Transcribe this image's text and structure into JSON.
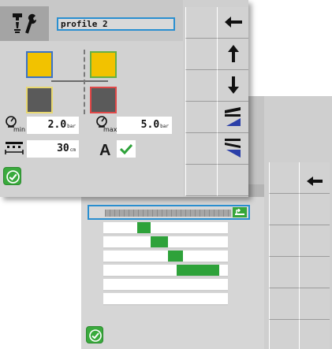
{
  "front": {
    "header": {
      "profile_name": "profile 2"
    },
    "pressure": {
      "min_sub": "min",
      "min_value": "2.0",
      "min_unit": "bar",
      "max_sub": "max",
      "max_value": "5.0",
      "max_unit": "bar"
    },
    "spacing": {
      "value": "30",
      "unit": "cm"
    },
    "auto": {
      "label": "A"
    },
    "colors": {
      "yellow": "#f2c200",
      "dark": "#5a5a5a",
      "green": "#36a63a",
      "blue": "#2a8fd0",
      "red": "#e04848"
    },
    "icons": {
      "tool": "tool-settings-icon",
      "back": "arrow-left-icon",
      "up": "arrow-up-icon",
      "down": "arrow-down-icon",
      "raise": "boom-raise-icon",
      "lower": "boom-lower-icon",
      "ok": "checkmark-circle-icon"
    }
  },
  "back": {
    "timeline": {
      "progress": 0.9,
      "rows": [
        {
          "start": 0.27,
          "end": 0.38
        },
        {
          "start": 0.38,
          "end": 0.52
        },
        {
          "start": 0.52,
          "end": 0.64
        },
        {
          "start": 0.59,
          "end": 0.93
        },
        {
          "start": 0,
          "end": 0
        },
        {
          "start": 0,
          "end": 0
        }
      ]
    }
  }
}
